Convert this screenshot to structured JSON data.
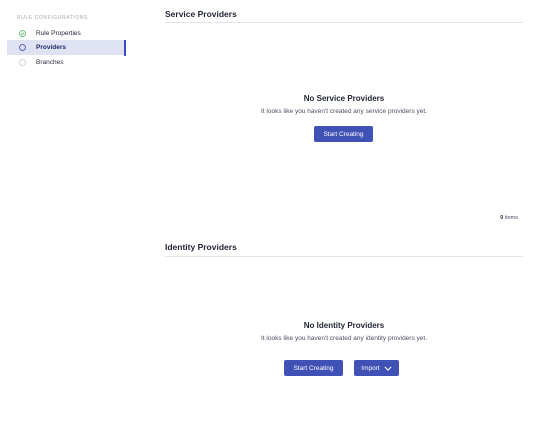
{
  "sidebar": {
    "heading": "RULE CONFIGURATIONS",
    "items": [
      {
        "label": "Rule Properties",
        "icon": "check-circle-icon",
        "state": "done"
      },
      {
        "label": "Providers",
        "icon": "circle-icon",
        "state": "active"
      },
      {
        "label": "Branches",
        "icon": "circle-icon",
        "state": "pending"
      }
    ]
  },
  "service_providers": {
    "title": "Service Providers",
    "empty_title": "No Service Providers",
    "empty_desc": "It looks like you haven't created any service providers yet.",
    "create_label": "Start Creating",
    "count_value": "0",
    "count_unit": "items"
  },
  "identity_providers": {
    "title": "Identity Providers",
    "empty_title": "No Identity Providers",
    "empty_desc": "It looks like you haven't created any identity providers yet.",
    "create_label": "Start Creating",
    "import_label": "Import"
  },
  "colors": {
    "accent": "#3f51b5",
    "active_bg": "#dfe2f3",
    "success": "#2ea84a"
  }
}
